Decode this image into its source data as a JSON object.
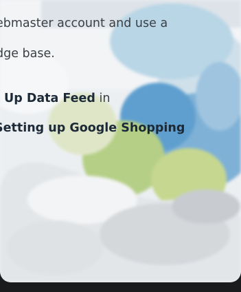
{
  "intro": {
    "line1": "ebmaster account and use a",
    "line2": "dge base."
  },
  "instruction": {
    "link_data_feed": "Up Data Feed",
    "suffix_in": " in",
    "link_google_shopping": "Setting up Google Shopping"
  },
  "colors": {
    "text": "#3b3f44",
    "bold_text": "#1c2a38",
    "frame": "#1a1b1d"
  },
  "illustration": "blurred-logo-globe"
}
